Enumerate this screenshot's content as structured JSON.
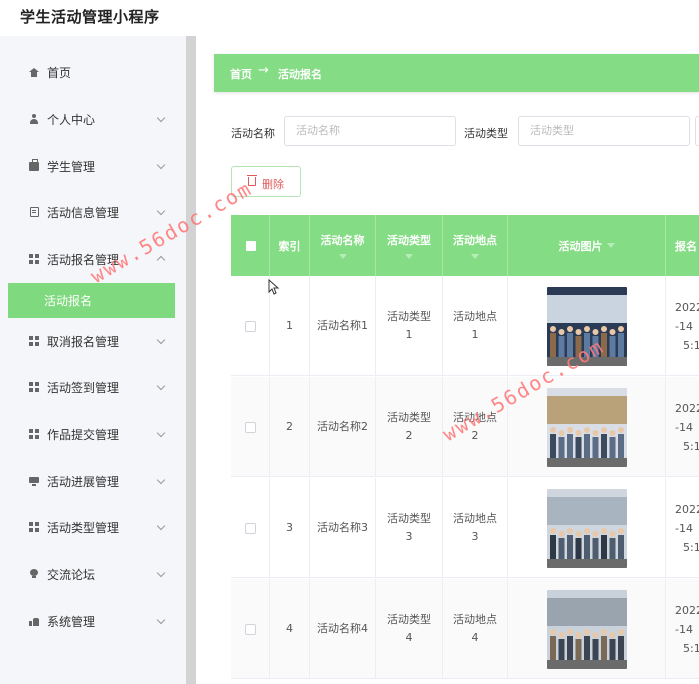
{
  "app": {
    "title": "学生活动管理小程序"
  },
  "sidebar": {
    "items": [
      {
        "label": "首页",
        "icon": "home-icon",
        "has_children": false
      },
      {
        "label": "个人中心",
        "icon": "user-icon",
        "has_children": true
      },
      {
        "label": "学生管理",
        "icon": "briefcase-icon",
        "has_children": true
      },
      {
        "label": "活动信息管理",
        "icon": "document-icon",
        "has_children": true
      },
      {
        "label": "活动报名管理",
        "icon": "grid-icon",
        "has_children": true
      },
      {
        "label": "取消报名管理",
        "icon": "grid-icon",
        "has_children": true
      },
      {
        "label": "活动签到管理",
        "icon": "grid-icon",
        "has_children": true
      },
      {
        "label": "作品提交管理",
        "icon": "grid-icon",
        "has_children": true
      },
      {
        "label": "活动进展管理",
        "icon": "monitor-icon",
        "has_children": true
      },
      {
        "label": "活动类型管理",
        "icon": "grid-icon",
        "has_children": true
      },
      {
        "label": "交流论坛",
        "icon": "lightbulb-icon",
        "has_children": true
      },
      {
        "label": "系统管理",
        "icon": "thumbs-up-icon",
        "has_children": true
      }
    ],
    "active_submenu": "活动报名"
  },
  "breadcrumb": {
    "home": "首页",
    "separator": "→",
    "current": "活动报名"
  },
  "search": {
    "name_label": "活动名称",
    "name_placeholder": "活动名称",
    "type_label": "活动类型",
    "type_placeholder": "活动类型"
  },
  "toolbar": {
    "delete_label": "删除"
  },
  "table": {
    "columns": [
      "索引",
      "活动名称",
      "活动类型",
      "活动地点",
      "活动图片",
      "报名"
    ],
    "rows": [
      {
        "index": "1",
        "name": "活动名称1",
        "type_line1": "活动类型",
        "type_line2": "1",
        "place_line1": "活动地点",
        "place_line2": "1",
        "date_line1": "2022",
        "date_line2": "-14",
        "date_line3": "5:1"
      },
      {
        "index": "2",
        "name": "活动名称2",
        "type_line1": "活动类型",
        "type_line2": "2",
        "place_line1": "活动地点",
        "place_line2": "2",
        "date_line1": "2022",
        "date_line2": "-14",
        "date_line3": "5:1"
      },
      {
        "index": "3",
        "name": "活动名称3",
        "type_line1": "活动类型",
        "type_line2": "3",
        "place_line1": "活动地点",
        "place_line2": "3",
        "date_line1": "2022",
        "date_line2": "-14",
        "date_line3": "5:1"
      },
      {
        "index": "4",
        "name": "活动名称4",
        "type_line1": "活动类型",
        "type_line2": "4",
        "place_line1": "活动地点",
        "place_line2": "4",
        "date_line1": "2022",
        "date_line2": "-14",
        "date_line3": "5:1"
      }
    ]
  },
  "watermarks": [
    "www.56doc.com",
    "www.56doc.com",
    "www.56doc.com"
  ],
  "colors": {
    "accent": "#84dc84",
    "delete": "#e05a5a",
    "watermark": "#ff7a7a"
  }
}
